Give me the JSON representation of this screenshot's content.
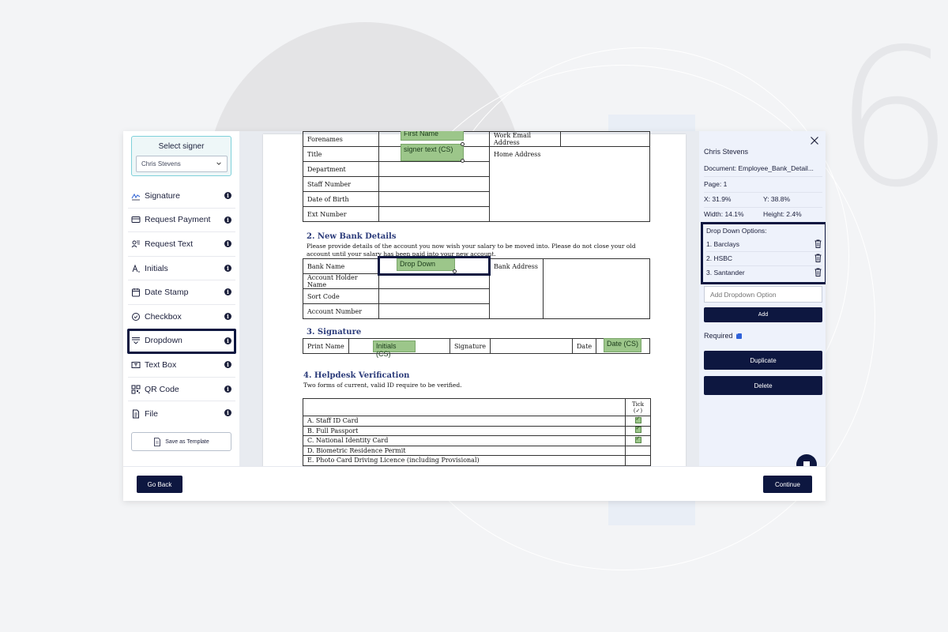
{
  "signer": {
    "title": "Select signer",
    "selected": "Chris Stevens"
  },
  "tools": [
    {
      "label": "Signature",
      "icon": "signature-icon"
    },
    {
      "label": "Request Payment",
      "icon": "payment-card-icon"
    },
    {
      "label": "Request Text",
      "icon": "request-text-icon"
    },
    {
      "label": "Initials",
      "icon": "initials-icon"
    },
    {
      "label": "Date Stamp",
      "icon": "calendar-icon"
    },
    {
      "label": "Checkbox",
      "icon": "checkbox-icon"
    },
    {
      "label": "Dropdown",
      "icon": "dropdown-icon"
    },
    {
      "label": "Text Box",
      "icon": "textbox-icon"
    },
    {
      "label": "QR Code",
      "icon": "qr-code-icon"
    },
    {
      "label": "File",
      "icon": "file-icon"
    }
  ],
  "save_template_label": "Save as Template",
  "document": {
    "personal_rows": [
      {
        "label": "Forenames",
        "label2": "Work Email Address"
      },
      {
        "label": "Title",
        "label2": "Home Address"
      },
      {
        "label": "Department"
      },
      {
        "label": "Staff Number"
      },
      {
        "label": "Date of Birth"
      },
      {
        "label": "Ext Number"
      }
    ],
    "section2_title": "2. New Bank Details",
    "section2_text": "Please provide details of the account you now wish your salary to be moved into.  Please do not close your old account until your salary has been paid into your new account.",
    "bank_rows": [
      "Bank Name",
      "Account Holder Name",
      "Sort Code",
      "Account Number"
    ],
    "bank_address_label": "Bank Address",
    "section3_title": "3. Signature",
    "signature_labels": {
      "print_name": "Print Name",
      "signature": "Signature",
      "date": "Date"
    },
    "section4_title": "4. Helpdesk Verification",
    "section4_text": "Two forms of current, valid ID require to be verified.",
    "tick_header": "Tick (✓)",
    "id_items": [
      {
        "label": "A.   Staff ID Card",
        "ticked": true
      },
      {
        "label": "B.   Full Passport",
        "ticked": true
      },
      {
        "label": "C.   National Identity Card",
        "ticked": true
      },
      {
        "label": "D.   Biometric Residence Permit",
        "ticked": false
      },
      {
        "label": "E.   Photo Card Driving Licence (including Provisional)",
        "ticked": false
      }
    ],
    "fields": {
      "first_name": "First Name",
      "signer_text": "signer text (CS)",
      "drop_down": "Drop Down",
      "initials": "Initials (CS)",
      "date": "Date (CS)"
    }
  },
  "properties": {
    "name": "Chris Stevens",
    "document": "Document: Employee_Bank_Detail...",
    "page": "Page: 1",
    "x": "X: 31.9%",
    "y": "Y: 38.8%",
    "width": "Width: 14.1%",
    "height": "Height: 2.4%",
    "dropdown_title": "Drop Down Options:",
    "options": [
      "1. Barclays",
      "2. HSBC",
      "3. Santander"
    ],
    "add_placeholder": "Add Dropdown Option",
    "add_label": "Add",
    "required_label": "Required",
    "duplicate_label": "Duplicate",
    "delete_label": "Delete"
  },
  "footer": {
    "go_back": "Go Back",
    "continue": "Continue"
  },
  "decoration_number": "6",
  "colors": {
    "navy": "#0d1740",
    "field_green": "#9cc68a",
    "accent_teal": "#7fd1da"
  }
}
